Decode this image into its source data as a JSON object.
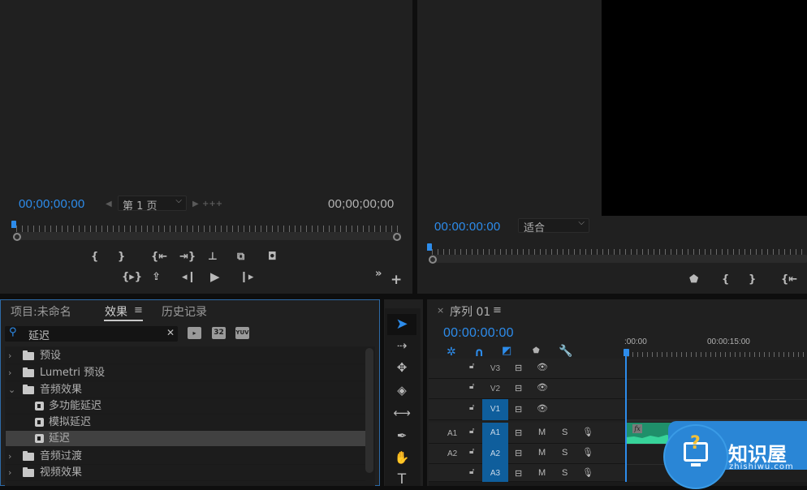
{
  "source_monitor": {
    "timecode_left": "00;00;00;00",
    "timecode_right": "00;00;00;00",
    "page_select": "第 1 页",
    "buttons_row1": [
      "mark-in",
      "mark-out",
      "go-to-in",
      "go-to-out",
      "insert",
      "overlay",
      "export-frame"
    ],
    "buttons_row2": [
      "play-in-to-out",
      "lift",
      "step-back",
      "play",
      "step-forward"
    ],
    "more_label": "»",
    "add_label": "+"
  },
  "program_monitor": {
    "timecode": "00:00:00:00",
    "zoom_select": "适合",
    "buttons": [
      "add-marker",
      "mark-in",
      "mark-out",
      "go-to-in"
    ]
  },
  "effects_panel": {
    "tabs": [
      {
        "label": "项目:未命名",
        "active": false
      },
      {
        "label": "效果",
        "active": true
      },
      {
        "label": "历史记录",
        "active": false
      }
    ],
    "menu_icon": "≡",
    "search": {
      "value": "延迟",
      "clear": "✕"
    },
    "filter_buttons": [
      "accelerated-effects",
      "32",
      "YUV"
    ],
    "tree": [
      {
        "label": "预设",
        "type": "preset-folder",
        "expanded": false,
        "indent": 0
      },
      {
        "label": "Lumetri 预设",
        "type": "preset-folder",
        "expanded": false,
        "indent": 0
      },
      {
        "label": "音频效果",
        "type": "folder",
        "expanded": true,
        "indent": 0
      },
      {
        "label": "多功能延迟",
        "type": "effect",
        "indent": 1
      },
      {
        "label": "模拟延迟",
        "type": "effect",
        "indent": 1
      },
      {
        "label": "延迟",
        "type": "effect",
        "indent": 1,
        "selected": true
      },
      {
        "label": "音频过渡",
        "type": "folder",
        "expanded": false,
        "indent": 0
      },
      {
        "label": "视频效果",
        "type": "folder",
        "expanded": false,
        "indent": 0
      }
    ]
  },
  "tools": [
    "selection",
    "track-select-forward",
    "ripple-edit",
    "razor",
    "slip",
    "pen",
    "hand",
    "type"
  ],
  "timeline": {
    "tab_close": "×",
    "sequence_name": "序列 01",
    "menu_icon": "≡",
    "timecode": "00:00:00:00",
    "ruler_labels": [
      ":00:00",
      "00:00:15:00"
    ],
    "video_tracks": [
      {
        "name": "V3",
        "targeted": false
      },
      {
        "name": "V2",
        "targeted": false
      },
      {
        "name": "V1",
        "targeted": true
      }
    ],
    "audio_tracks": [
      {
        "source": "A1",
        "name": "A1",
        "mute": "M",
        "solo": "S"
      },
      {
        "source": "A2",
        "name": "A2",
        "mute": "M",
        "solo": "S"
      },
      {
        "source": "",
        "name": "A3",
        "mute": "M",
        "solo": "S"
      }
    ],
    "clip_fx_label": "fx"
  },
  "watermark": {
    "title": "知识屋",
    "subtitle": "zhishiwu.com",
    "icon": "?"
  },
  "colors": {
    "accent": "#2d8ceb",
    "track_target": "#0f5e9c",
    "audio_clip": "#2ebd8a",
    "watermark": "#2a86d6"
  }
}
